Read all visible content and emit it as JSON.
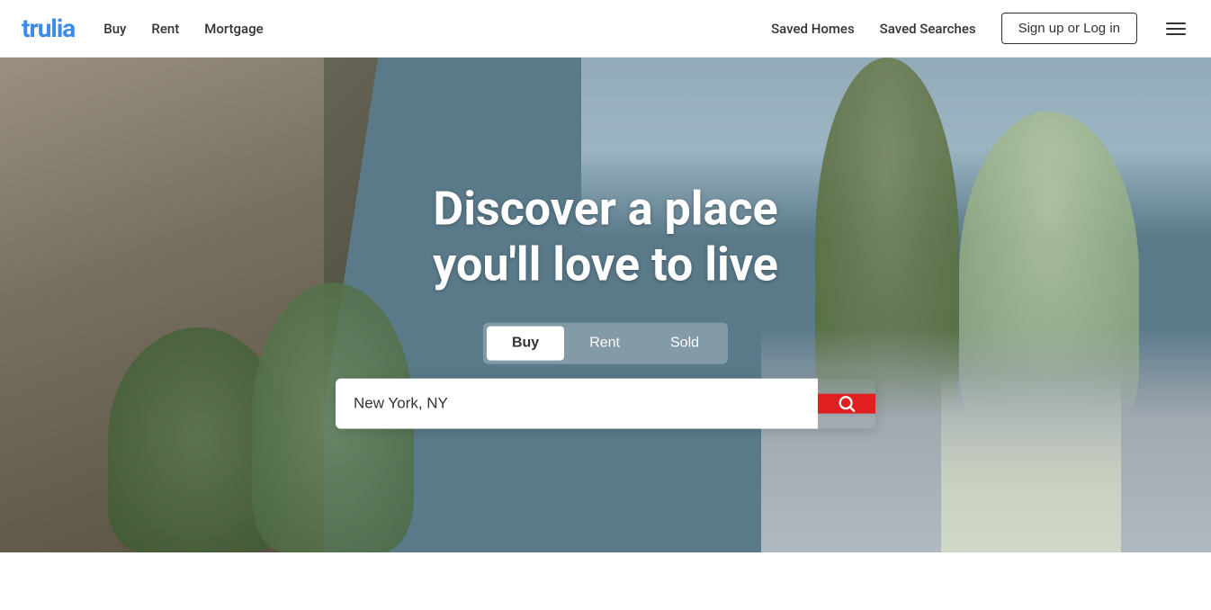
{
  "header": {
    "logo": "trulia",
    "nav": {
      "buy_label": "Buy",
      "rent_label": "Rent",
      "mortgage_label": "Mortgage"
    },
    "right": {
      "saved_homes_label": "Saved Homes",
      "saved_searches_label": "Saved Searches",
      "sign_up_label": "Sign up or Log in"
    }
  },
  "hero": {
    "title_line1": "Discover a place",
    "title_line2": "you'll love to live",
    "tabs": [
      {
        "label": "Buy",
        "active": true
      },
      {
        "label": "Rent",
        "active": false
      },
      {
        "label": "Sold",
        "active": false
      }
    ],
    "search_placeholder": "New York, NY",
    "search_value": "New York, NY"
  },
  "icons": {
    "search": "🔍",
    "hamburger": "☰"
  }
}
